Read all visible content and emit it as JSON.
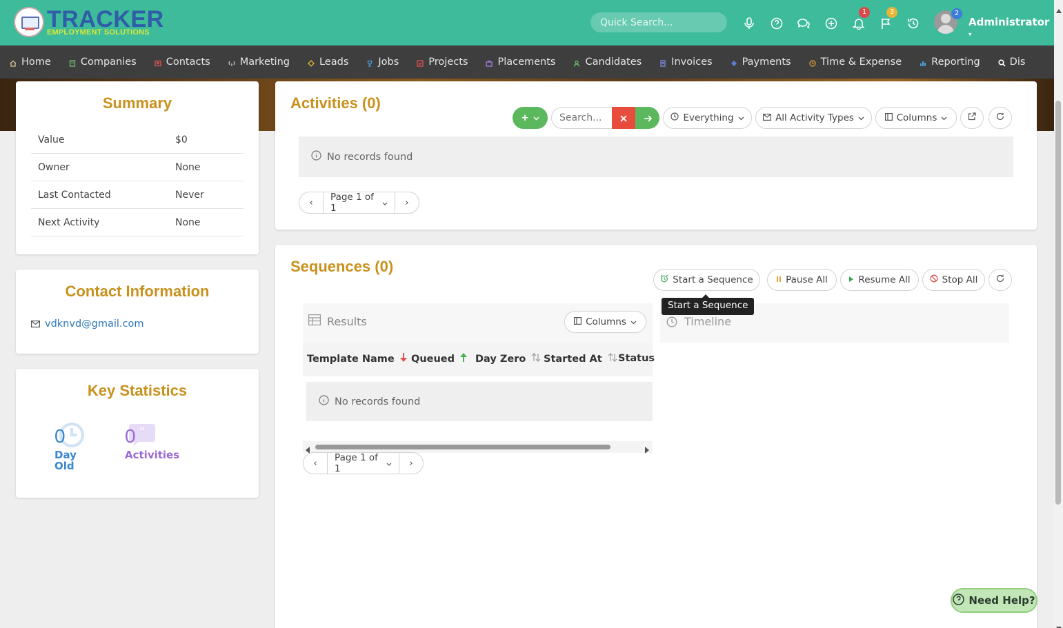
{
  "header": {
    "logo_title": "TRACKER",
    "logo_subtitle": "EMPLOYMENT SOLUTIONS",
    "search_placeholder": "Quick Search...",
    "badges": {
      "notifications": "1",
      "flags": "3",
      "user": "2"
    },
    "user_name": "Administrator"
  },
  "nav": {
    "items": [
      "Home",
      "Companies",
      "Contacts",
      "Marketing",
      "Leads",
      "Jobs",
      "Projects",
      "Placements",
      "Candidates",
      "Invoices",
      "Payments",
      "Time & Expense",
      "Reporting",
      "Dis"
    ]
  },
  "summary": {
    "title": "Summary",
    "rows": [
      {
        "label": "Value",
        "value": "$0"
      },
      {
        "label": "Owner",
        "value": "None"
      },
      {
        "label": "Last Contacted",
        "value": "Never"
      },
      {
        "label": "Next Activity",
        "value": "None"
      }
    ]
  },
  "contact": {
    "title": "Contact Information",
    "email": "vdknvd@gmail.com"
  },
  "stats": {
    "title": "Key Statistics",
    "day_old_value": "0",
    "day_old_label_1": "Day",
    "day_old_label_2": "Old",
    "activities_value": "0",
    "activities_label": "Activities"
  },
  "activities": {
    "title": "Activities (0)",
    "add_label": "+",
    "search_placeholder": "Search...",
    "filter_everything": "Everything",
    "filter_types": "All Activity Types",
    "columns_label": "Columns",
    "empty_text": "No records found",
    "page_label": "Page 1 of 1"
  },
  "sequences": {
    "title": "Sequences (0)",
    "start_label": "Start a Sequence",
    "pause_label": "Pause All",
    "resume_label": "Resume All",
    "stop_label": "Stop All",
    "tooltip": "Start a Sequence",
    "results_label": "Results",
    "columns_label": "Columns",
    "timeline_label": "Timeline",
    "headers": [
      "Template Name",
      "Queued",
      "Day Zero",
      "Started At",
      "Status"
    ],
    "empty_text": "No records found",
    "page_label": "Page 1 of 1"
  },
  "help": {
    "label": "Need Help?"
  },
  "colors": {
    "header_bg": "#3dbb9b",
    "nav_bg": "#3e3e3e",
    "accent_gold": "#c9911c",
    "green_button": "#5cb85c",
    "red_button": "#e74c3c"
  }
}
